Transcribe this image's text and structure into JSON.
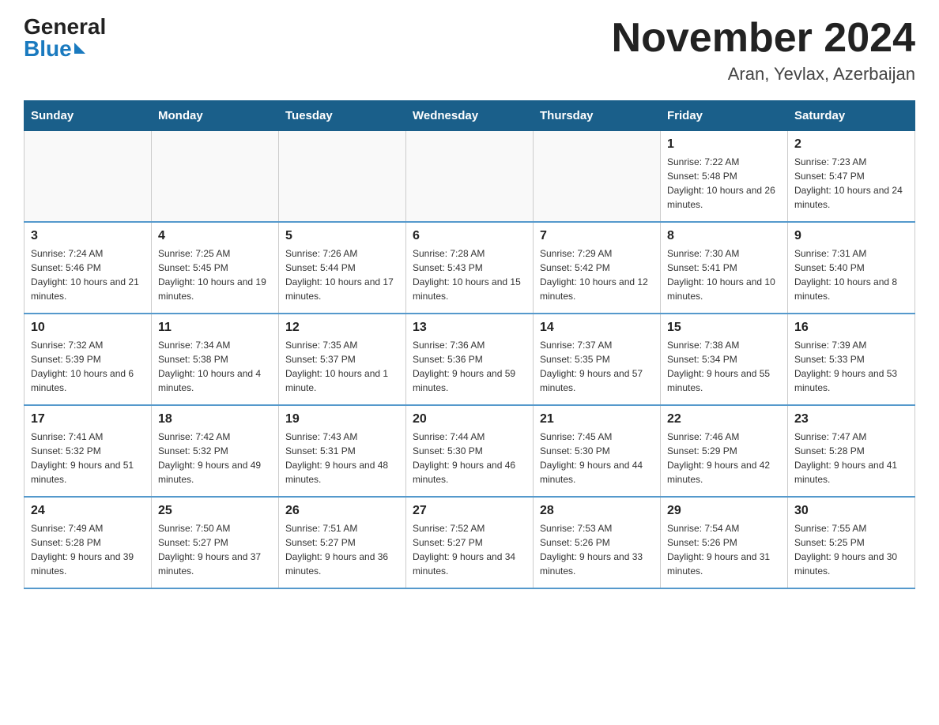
{
  "header": {
    "logo_general": "General",
    "logo_blue": "Blue",
    "title": "November 2024",
    "subtitle": "Aran, Yevlax, Azerbaijan"
  },
  "weekdays": [
    "Sunday",
    "Monday",
    "Tuesday",
    "Wednesday",
    "Thursday",
    "Friday",
    "Saturday"
  ],
  "weeks": [
    [
      {
        "day": "",
        "info": ""
      },
      {
        "day": "",
        "info": ""
      },
      {
        "day": "",
        "info": ""
      },
      {
        "day": "",
        "info": ""
      },
      {
        "day": "",
        "info": ""
      },
      {
        "day": "1",
        "info": "Sunrise: 7:22 AM\nSunset: 5:48 PM\nDaylight: 10 hours and 26 minutes."
      },
      {
        "day": "2",
        "info": "Sunrise: 7:23 AM\nSunset: 5:47 PM\nDaylight: 10 hours and 24 minutes."
      }
    ],
    [
      {
        "day": "3",
        "info": "Sunrise: 7:24 AM\nSunset: 5:46 PM\nDaylight: 10 hours and 21 minutes."
      },
      {
        "day": "4",
        "info": "Sunrise: 7:25 AM\nSunset: 5:45 PM\nDaylight: 10 hours and 19 minutes."
      },
      {
        "day": "5",
        "info": "Sunrise: 7:26 AM\nSunset: 5:44 PM\nDaylight: 10 hours and 17 minutes."
      },
      {
        "day": "6",
        "info": "Sunrise: 7:28 AM\nSunset: 5:43 PM\nDaylight: 10 hours and 15 minutes."
      },
      {
        "day": "7",
        "info": "Sunrise: 7:29 AM\nSunset: 5:42 PM\nDaylight: 10 hours and 12 minutes."
      },
      {
        "day": "8",
        "info": "Sunrise: 7:30 AM\nSunset: 5:41 PM\nDaylight: 10 hours and 10 minutes."
      },
      {
        "day": "9",
        "info": "Sunrise: 7:31 AM\nSunset: 5:40 PM\nDaylight: 10 hours and 8 minutes."
      }
    ],
    [
      {
        "day": "10",
        "info": "Sunrise: 7:32 AM\nSunset: 5:39 PM\nDaylight: 10 hours and 6 minutes."
      },
      {
        "day": "11",
        "info": "Sunrise: 7:34 AM\nSunset: 5:38 PM\nDaylight: 10 hours and 4 minutes."
      },
      {
        "day": "12",
        "info": "Sunrise: 7:35 AM\nSunset: 5:37 PM\nDaylight: 10 hours and 1 minute."
      },
      {
        "day": "13",
        "info": "Sunrise: 7:36 AM\nSunset: 5:36 PM\nDaylight: 9 hours and 59 minutes."
      },
      {
        "day": "14",
        "info": "Sunrise: 7:37 AM\nSunset: 5:35 PM\nDaylight: 9 hours and 57 minutes."
      },
      {
        "day": "15",
        "info": "Sunrise: 7:38 AM\nSunset: 5:34 PM\nDaylight: 9 hours and 55 minutes."
      },
      {
        "day": "16",
        "info": "Sunrise: 7:39 AM\nSunset: 5:33 PM\nDaylight: 9 hours and 53 minutes."
      }
    ],
    [
      {
        "day": "17",
        "info": "Sunrise: 7:41 AM\nSunset: 5:32 PM\nDaylight: 9 hours and 51 minutes."
      },
      {
        "day": "18",
        "info": "Sunrise: 7:42 AM\nSunset: 5:32 PM\nDaylight: 9 hours and 49 minutes."
      },
      {
        "day": "19",
        "info": "Sunrise: 7:43 AM\nSunset: 5:31 PM\nDaylight: 9 hours and 48 minutes."
      },
      {
        "day": "20",
        "info": "Sunrise: 7:44 AM\nSunset: 5:30 PM\nDaylight: 9 hours and 46 minutes."
      },
      {
        "day": "21",
        "info": "Sunrise: 7:45 AM\nSunset: 5:30 PM\nDaylight: 9 hours and 44 minutes."
      },
      {
        "day": "22",
        "info": "Sunrise: 7:46 AM\nSunset: 5:29 PM\nDaylight: 9 hours and 42 minutes."
      },
      {
        "day": "23",
        "info": "Sunrise: 7:47 AM\nSunset: 5:28 PM\nDaylight: 9 hours and 41 minutes."
      }
    ],
    [
      {
        "day": "24",
        "info": "Sunrise: 7:49 AM\nSunset: 5:28 PM\nDaylight: 9 hours and 39 minutes."
      },
      {
        "day": "25",
        "info": "Sunrise: 7:50 AM\nSunset: 5:27 PM\nDaylight: 9 hours and 37 minutes."
      },
      {
        "day": "26",
        "info": "Sunrise: 7:51 AM\nSunset: 5:27 PM\nDaylight: 9 hours and 36 minutes."
      },
      {
        "day": "27",
        "info": "Sunrise: 7:52 AM\nSunset: 5:27 PM\nDaylight: 9 hours and 34 minutes."
      },
      {
        "day": "28",
        "info": "Sunrise: 7:53 AM\nSunset: 5:26 PM\nDaylight: 9 hours and 33 minutes."
      },
      {
        "day": "29",
        "info": "Sunrise: 7:54 AM\nSunset: 5:26 PM\nDaylight: 9 hours and 31 minutes."
      },
      {
        "day": "30",
        "info": "Sunrise: 7:55 AM\nSunset: 5:25 PM\nDaylight: 9 hours and 30 minutes."
      }
    ]
  ]
}
